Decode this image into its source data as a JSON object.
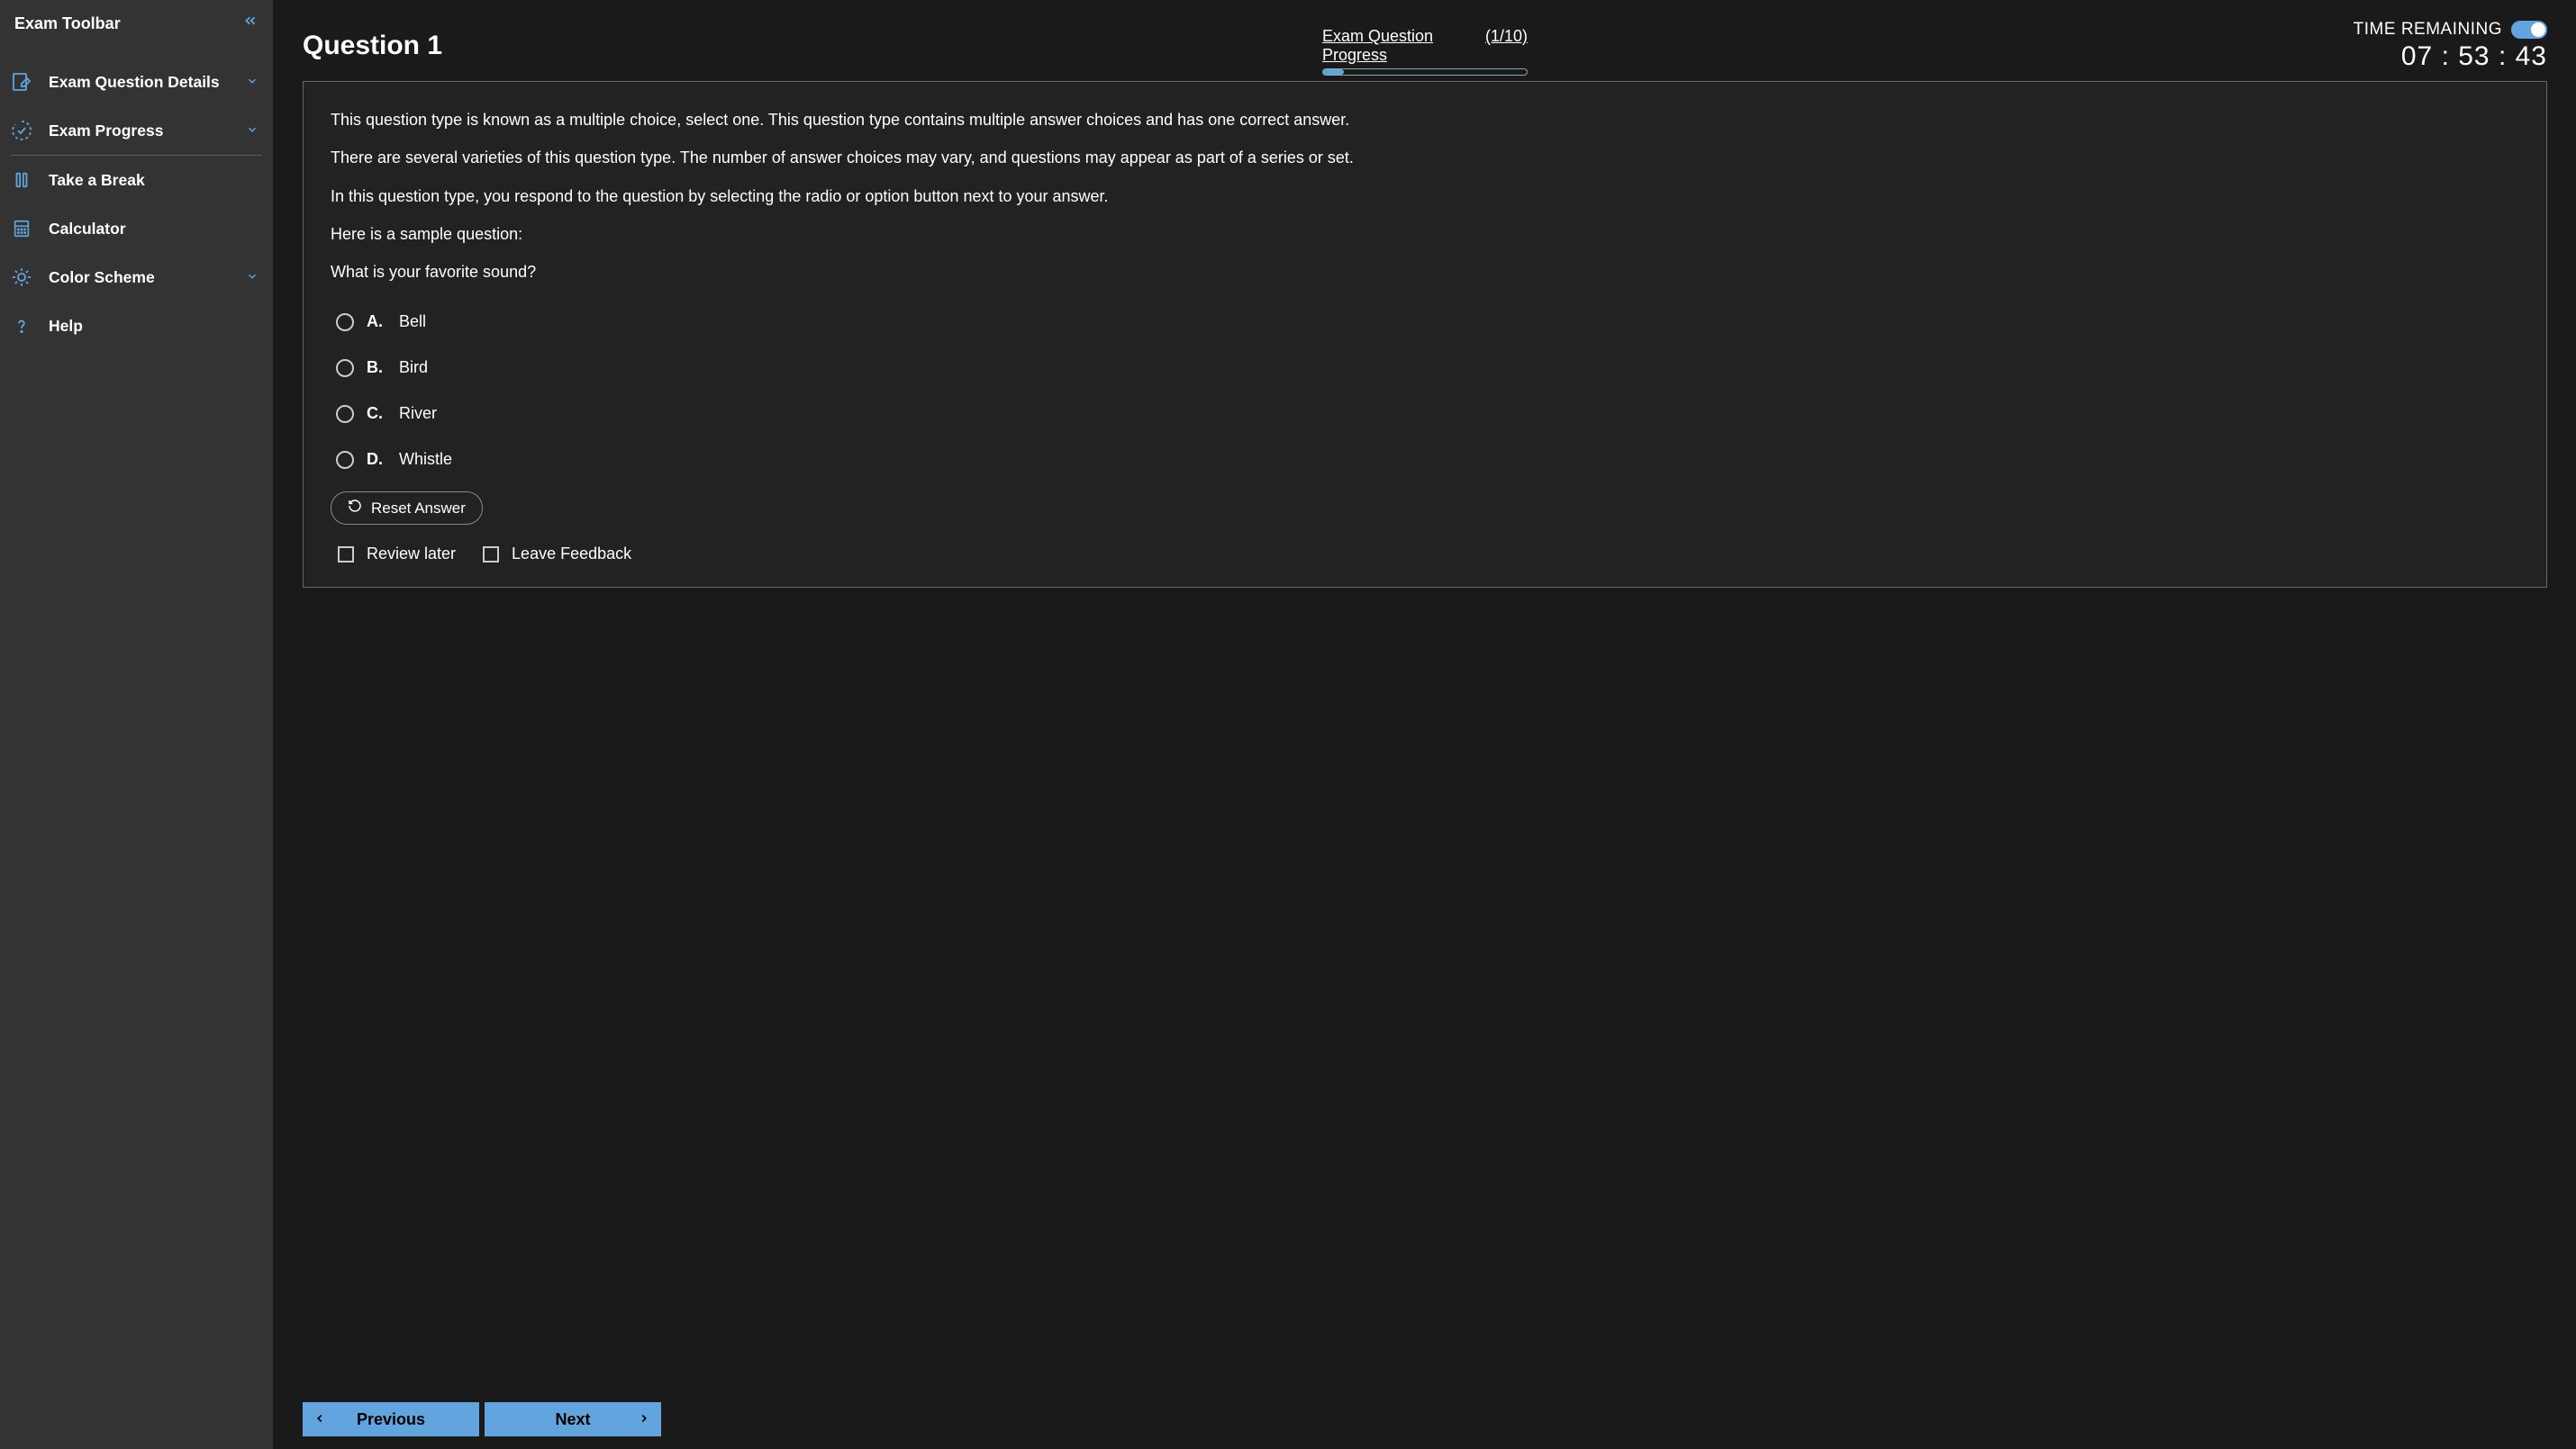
{
  "sidebar": {
    "title": "Exam Toolbar",
    "items": [
      {
        "label": "Exam Question Details",
        "hasChevron": true
      },
      {
        "label": "Exam Progress",
        "hasChevron": true
      },
      {
        "label": "Take a Break",
        "hasChevron": false
      },
      {
        "label": "Calculator",
        "hasChevron": false
      },
      {
        "label": "Color Scheme",
        "hasChevron": true
      },
      {
        "label": "Help",
        "hasChevron": false
      }
    ]
  },
  "header": {
    "question_title": "Question 1",
    "progress_label": "Exam Question Progress",
    "progress_count": "(1/10)",
    "progress_percent": 10,
    "timer_label": "TIME REMAINING",
    "timer_value": "07 : 53 : 43"
  },
  "question": {
    "paragraphs": [
      "This question type is known as a multiple choice, select one. This question type contains multiple answer choices and has one correct answer.",
      "There are several varieties of this question type. The number of answer choices may vary, and questions may appear as part of a series or set.",
      "In this question type, you respond to the question by selecting the radio or option button next to your answer.",
      "Here is a sample question:",
      "What is your favorite sound?"
    ],
    "choices": [
      {
        "letter": "A.",
        "text": "Bell"
      },
      {
        "letter": "B.",
        "text": "Bird"
      },
      {
        "letter": "C.",
        "text": "River"
      },
      {
        "letter": "D.",
        "text": "Whistle"
      }
    ],
    "reset_label": "Reset Answer",
    "review_label": "Review later",
    "feedback_label": "Leave Feedback"
  },
  "nav": {
    "prev": "Previous",
    "next": "Next"
  }
}
